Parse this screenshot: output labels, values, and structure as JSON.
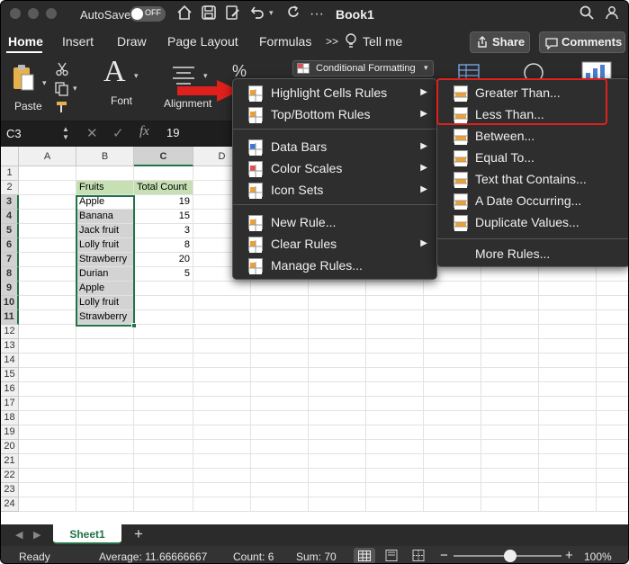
{
  "titlebar": {
    "autosave_label": "AutoSave",
    "autosave_state": "OFF",
    "doc_title": "Book1"
  },
  "tabs": [
    "Home",
    "Insert",
    "Draw",
    "Page Layout",
    "Formulas"
  ],
  "tell_me": "Tell me",
  "share_label": "Share",
  "comments_label": "Comments",
  "ribbon": {
    "paste": "Paste",
    "font": "Font",
    "alignment": "Alignment",
    "conditional_formatting": "Conditional Formatting"
  },
  "formula_bar": {
    "name_box": "C3",
    "fx": "fx",
    "value": "19"
  },
  "grid": {
    "columns": [
      "A",
      "B",
      "C",
      "D"
    ],
    "rows": [
      "1",
      "2",
      "3",
      "4",
      "5",
      "6",
      "7",
      "8",
      "9",
      "10",
      "11",
      "12",
      "13",
      "14",
      "15",
      "16",
      "17",
      "18",
      "19",
      "20",
      "21",
      "22",
      "23",
      "24"
    ],
    "header_fruits": "Fruits",
    "header_total": "Total Count",
    "fruits": [
      "Apple",
      "Banana",
      "Jack fruit",
      "Lolly fruit",
      "Strawberry",
      "Durian",
      "Apple",
      "Lolly fruit",
      "Strawberry"
    ],
    "counts": [
      "19",
      "15",
      "3",
      "8",
      "20",
      "5"
    ]
  },
  "menu": {
    "items": [
      {
        "label": "Highlight Cells Rules",
        "submenu": true
      },
      {
        "label": "Top/Bottom Rules",
        "submenu": true
      },
      {
        "label": "Data Bars",
        "submenu": true
      },
      {
        "label": "Color Scales",
        "submenu": true
      },
      {
        "label": "Icon Sets",
        "submenu": true
      },
      {
        "label": "New Rule...",
        "submenu": false
      },
      {
        "label": "Clear Rules",
        "submenu": true
      },
      {
        "label": "Manage Rules...",
        "submenu": false
      }
    ]
  },
  "submenu": {
    "items": [
      "Greater Than...",
      "Less Than...",
      "Between...",
      "Equal To...",
      "Text that Contains...",
      "A Date Occurring...",
      "Duplicate Values..."
    ],
    "more": "More Rules..."
  },
  "sheet_tab": "Sheet1",
  "add_sheet": "+",
  "status": {
    "ready": "Ready",
    "average": "Average: 11.66666667",
    "count": "Count: 6",
    "sum": "Sum: 70",
    "zoom": "100%",
    "minus": "−",
    "plus": "+"
  },
  "colors": {
    "annotation_red": "#e0201c",
    "header_green": "#c6e0b4",
    "selection_green": "#217346"
  }
}
